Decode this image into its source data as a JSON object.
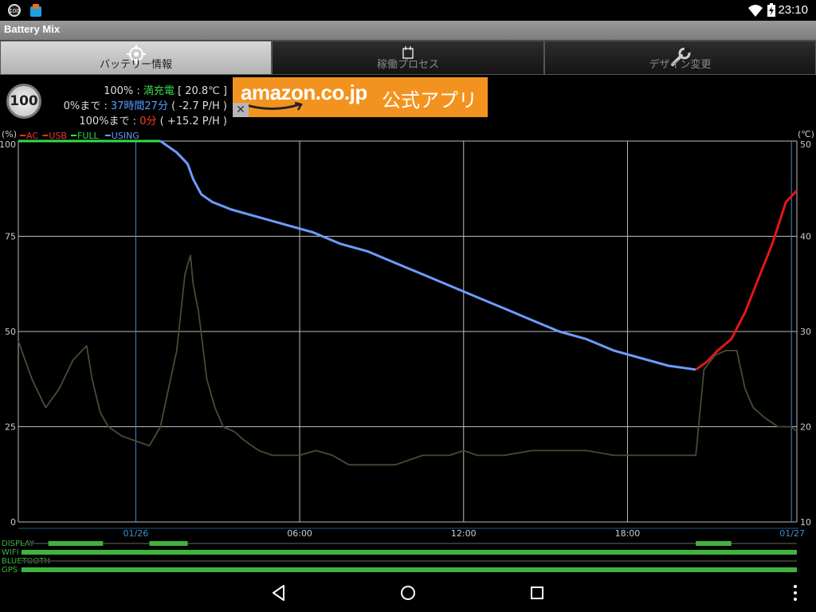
{
  "status_bar": {
    "time": "23:10",
    "notification_badge": "100",
    "icons": [
      "battery-badge-icon",
      "app-notify-icon",
      "wifi-icon",
      "battery-charging-icon"
    ]
  },
  "app": {
    "title": "Battery Mix"
  },
  "tabs": [
    {
      "label": "バッテリー情報",
      "icon": "target-icon",
      "active": true
    },
    {
      "label": "稼働プロセス",
      "icon": "clipboard-icon",
      "active": false
    },
    {
      "label": "デザイン変更",
      "icon": "wrench-icon",
      "active": false
    }
  ],
  "info": {
    "level_badge": "100",
    "line1": {
      "pct": "100%",
      "sep": " : ",
      "status": "満充電",
      "temp": " [ 20.8℃ ]"
    },
    "line2": {
      "label": "0%まで",
      "sep": " : ",
      "time": "37時間27分",
      "rate": " ( -2.7 P/H )"
    },
    "line3": {
      "label": "100%まで",
      "sep": " : ",
      "time": "0分",
      "rate": " ( +15.2 P/H )"
    }
  },
  "ad": {
    "logo": "amazon.co.jp",
    "text": "公式アプリ",
    "close": "✕"
  },
  "chart_data": {
    "type": "line",
    "y_left_unit": "(%)",
    "y_right_unit": "(℃)",
    "y_left_ticks": [
      "100",
      "75",
      "50",
      "25",
      "0"
    ],
    "y_right_ticks": [
      "50",
      "40",
      "30",
      "20",
      "10"
    ],
    "ylim": [
      0,
      100
    ],
    "y2lim": [
      10,
      50
    ],
    "xlim": [
      -4.3,
      24.2
    ],
    "x_ticks": [
      {
        "x": 0,
        "label": "01/26",
        "highlight": true
      },
      {
        "x": 6,
        "label": "06:00",
        "highlight": false
      },
      {
        "x": 12,
        "label": "12:00",
        "highlight": false
      },
      {
        "x": 18,
        "label": "18:00",
        "highlight": false
      },
      {
        "x": 24,
        "label": "01/27",
        "highlight": true
      }
    ],
    "legend": [
      {
        "name": "AC",
        "color": "#ff3030"
      },
      {
        "name": "USB",
        "color": "#ff3030"
      },
      {
        "name": "FULL",
        "color": "#36d94a"
      },
      {
        "name": "USING",
        "color": "#6f9bff"
      }
    ],
    "series": [
      {
        "name": "FULL",
        "color": "#36d94a",
        "points": [
          [
            -4.3,
            100
          ],
          [
            0.9,
            100
          ]
        ]
      },
      {
        "name": "USING",
        "color": "#6f9bff",
        "points": [
          [
            0.9,
            100
          ],
          [
            1.5,
            97
          ],
          [
            1.9,
            94
          ],
          [
            2.1,
            90
          ],
          [
            2.4,
            86
          ],
          [
            2.8,
            84
          ],
          [
            3.5,
            82
          ],
          [
            4.5,
            80
          ],
          [
            5.5,
            78
          ],
          [
            6.5,
            76
          ],
          [
            7.5,
            73
          ],
          [
            8.5,
            71
          ],
          [
            9.5,
            68
          ],
          [
            10.5,
            65
          ],
          [
            11.5,
            62
          ],
          [
            12.5,
            59
          ],
          [
            13.5,
            56
          ],
          [
            14.5,
            53
          ],
          [
            15.5,
            50
          ],
          [
            16.5,
            48
          ],
          [
            17.5,
            45
          ],
          [
            18.5,
            43
          ],
          [
            19.5,
            41
          ],
          [
            20.5,
            40
          ]
        ]
      },
      {
        "name": "AC",
        "color": "#e01818",
        "points": [
          [
            20.5,
            40
          ],
          [
            20.9,
            42
          ],
          [
            21.3,
            45
          ],
          [
            21.8,
            48
          ],
          [
            22.3,
            55
          ],
          [
            22.8,
            64
          ],
          [
            23.3,
            73
          ],
          [
            23.8,
            84
          ],
          [
            24.2,
            87
          ]
        ]
      },
      {
        "name": "temperature",
        "axis": "right",
        "color": "#4a4a36",
        "points": [
          [
            -4.3,
            29
          ],
          [
            -3.8,
            25
          ],
          [
            -3.3,
            22
          ],
          [
            -2.8,
            24
          ],
          [
            -2.3,
            27
          ],
          [
            -1.8,
            28.5
          ],
          [
            -1.6,
            25
          ],
          [
            -1.3,
            21.5
          ],
          [
            -1.0,
            20
          ],
          [
            -0.5,
            19
          ],
          [
            0.0,
            18.5
          ],
          [
            0.5,
            18
          ],
          [
            0.9,
            20
          ],
          [
            1.2,
            24
          ],
          [
            1.5,
            28
          ],
          [
            1.8,
            36
          ],
          [
            2.0,
            38
          ],
          [
            2.1,
            35
          ],
          [
            2.3,
            32
          ],
          [
            2.6,
            25
          ],
          [
            2.9,
            22
          ],
          [
            3.2,
            20
          ],
          [
            3.6,
            19.5
          ],
          [
            4.0,
            18.5
          ],
          [
            4.5,
            17.5
          ],
          [
            5.0,
            17
          ],
          [
            5.5,
            17
          ],
          [
            6.0,
            17
          ],
          [
            6.6,
            17.5
          ],
          [
            7.2,
            17
          ],
          [
            7.8,
            16
          ],
          [
            8.5,
            16
          ],
          [
            9.5,
            16
          ],
          [
            10.5,
            17
          ],
          [
            11.5,
            17
          ],
          [
            12.0,
            17.5
          ],
          [
            12.5,
            17
          ],
          [
            13.5,
            17
          ],
          [
            14.5,
            17.5
          ],
          [
            15.5,
            17.5
          ],
          [
            16.5,
            17.5
          ],
          [
            17.5,
            17
          ],
          [
            18.5,
            17
          ],
          [
            19.5,
            17
          ],
          [
            20.5,
            17
          ],
          [
            20.8,
            26
          ],
          [
            21.2,
            27.5
          ],
          [
            21.6,
            28
          ],
          [
            22.0,
            28
          ],
          [
            22.3,
            24
          ],
          [
            22.6,
            22
          ],
          [
            23.0,
            21
          ],
          [
            23.5,
            20
          ],
          [
            24.0,
            20
          ],
          [
            24.2,
            19.5
          ]
        ]
      }
    ],
    "timeline": {
      "labels": [
        "DISPLAY",
        "WIFI",
        "BLUETOOTH",
        "GPS"
      ],
      "color": "#3fb23f",
      "segments": [
        [
          [
            -3.2,
            -1.2
          ],
          [
            0.5,
            1.9
          ],
          [
            20.5,
            21.8
          ]
        ],
        [
          [
            -4.3,
            24.2
          ]
        ],
        [],
        [
          [
            -4.3,
            24.2
          ]
        ]
      ]
    }
  }
}
